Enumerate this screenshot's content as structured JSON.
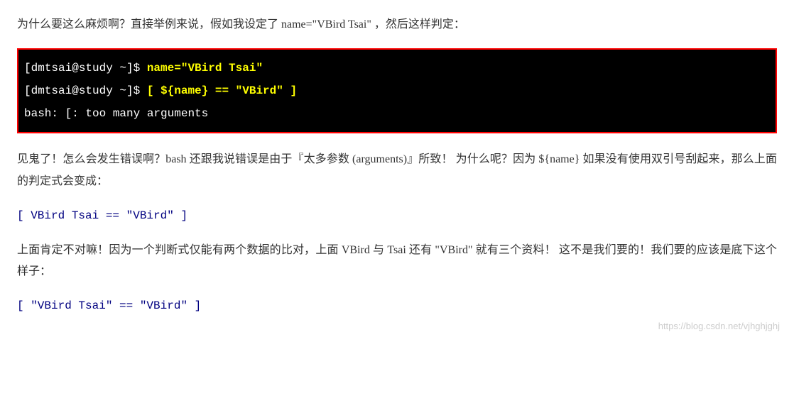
{
  "para1": "为什么要这么麻烦啊？直接举例来说，假如我设定了 name=\"VBird Tsai\" ，然后这样判定：",
  "terminal": {
    "line1_prompt": "[dmtsai@study ~]$ ",
    "line1_cmd": "name=\"VBird Tsai\"",
    "line2_prompt": "[dmtsai@study ~]$ ",
    "line2_cmd": "[ ${name} == \"VBird\" ]",
    "line3_output": "bash: [: too many arguments"
  },
  "para2": "见鬼了！怎么会发生错误啊？bash 还跟我说错误是由于『太多参数 (arguments)』所致！ 为什么呢？因为 ${name} 如果没有使用双引号刮起来，那么上面的判定式会变成：",
  "code1": "[ VBird Tsai == \"VBird\" ]",
  "para3": "上面肯定不对嘛！因为一个判断式仅能有两个数据的比对，上面 VBird 与 Tsai 还有 \"VBird\" 就有三个资料！ 这不是我们要的！我们要的应该是底下这个样子：",
  "code2": "[ \"VBird Tsai\" == \"VBird\" ]",
  "watermark": "https://blog.csdn.net/vjhghjghj"
}
